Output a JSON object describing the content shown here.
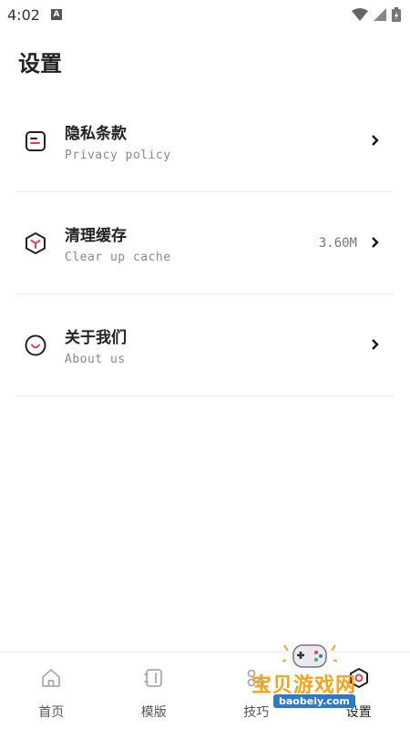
{
  "status_bar": {
    "time": "4:02",
    "notification_icon": "a-box-icon",
    "icons": [
      "wifi-icon",
      "signal-icon",
      "battery-icon"
    ]
  },
  "page": {
    "title": "设置"
  },
  "settings": [
    {
      "title": "隐私条款",
      "subtitle": "Privacy policy",
      "icon": "document-icon"
    },
    {
      "title": "清理缓存",
      "subtitle": "Clear up cache",
      "value": "3.60M",
      "icon": "cube-icon"
    },
    {
      "title": "关于我们",
      "subtitle": "About us",
      "icon": "smile-icon"
    }
  ],
  "tabs": [
    {
      "label": "首页",
      "icon": "home-icon"
    },
    {
      "label": "模版",
      "icon": "template-icon"
    },
    {
      "label": "技巧",
      "icon": "tips-icon"
    },
    {
      "label": "设置",
      "icon": "settings-icon",
      "active": true
    }
  ],
  "watermark": {
    "text": "宝贝游戏网",
    "url": "baobeiy.com"
  },
  "colors": {
    "accent": "#e0415d",
    "text": "#222222",
    "secondary_text": "#888888"
  }
}
